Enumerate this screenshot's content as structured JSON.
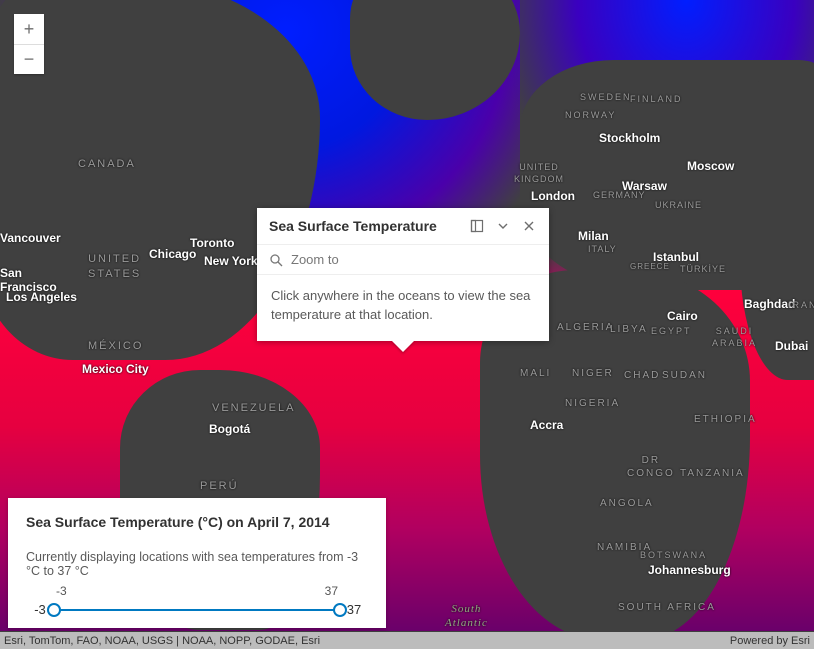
{
  "zoom": {
    "in": "+",
    "out": "−"
  },
  "popup": {
    "title": "Sea Surface Temperature",
    "zoom_to": "Zoom to",
    "body": "Click anywhere in the oceans to view the sea temperature at that location."
  },
  "legend": {
    "title": "Sea Surface Temperature (°C) on April 7, 2014",
    "desc": "Currently displaying locations with sea temperatures from -3 °C to 37 °C",
    "scale_min": "-3",
    "scale_max": "37",
    "min": "-3",
    "max": "37"
  },
  "attrib": {
    "left": "Esri, TomTom, FAO, NOAA, USGS | NOAA, NOPP, GODAE, Esri",
    "right": "Powered by Esri"
  },
  "labels": {
    "regions": {
      "canada": "CANADA",
      "us": "UNITED\nSTATES",
      "mexico": "MÉXICO",
      "venezuela": "VENEZUELA",
      "peru": "PERÚ",
      "uk": "UNITED\nKINGDOM",
      "germany": "GERMANY",
      "ukraine": "UKRAINE",
      "italy": "ITALY",
      "greece": "GREECE",
      "turkey": "TÜRKİYE",
      "algeria": "ALGERIA",
      "libya": "LIBYA",
      "egypt_r": "EGYPT",
      "saudi": "SAUDI\nARABIA",
      "mali": "MALI",
      "niger": "NIGER",
      "chad": "CHAD",
      "sudan": "SUDAN",
      "nigeria": "NIGERIA",
      "ethiopia": "ETHIOPIA",
      "drc": "DR\nCONGO",
      "tanzania": "TANZANIA",
      "angola": "ANGOLA",
      "namibia": "NAMIBIA",
      "botswana": "BOTSWANA",
      "southafrica": "SOUTH AFRICA",
      "sweden": "SWEDEN",
      "finland": "FINLAND",
      "norway": "NORWAY"
    },
    "cities": {
      "vancouver": "Vancouver",
      "sf": "San\nFrancisco",
      "la": "Los Angeles",
      "chicago": "Chicago",
      "toronto": "Toronto",
      "newyork": "New York",
      "mexicocity": "Mexico City",
      "bogota": "Bogotá",
      "london": "London",
      "stockholm": "Stockholm",
      "warsaw": "Warsaw",
      "moscow": "Moscow",
      "milan": "Milan",
      "istanbul": "Istanbul",
      "cairo": "Cairo",
      "baghdad": "Baghdad",
      "dubai": "Dubai",
      "accra": "Accra",
      "johannesburg": "Johannesburg",
      "iran": "IRAN"
    },
    "water": {
      "satl": "South\nAtlantic"
    }
  }
}
